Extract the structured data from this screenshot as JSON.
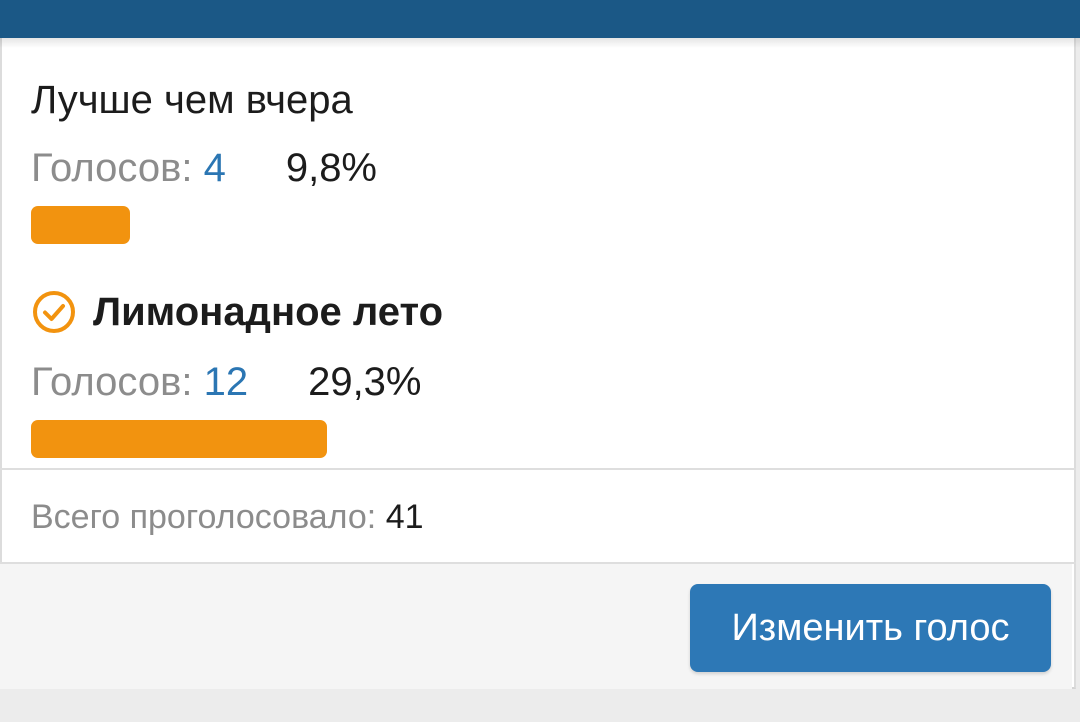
{
  "poll": {
    "options": [
      {
        "title": "Лучше чем вчера",
        "votes_label": "Голосов:",
        "votes": "4",
        "percent": "9,8%",
        "fraction": 0.098,
        "selected": false
      },
      {
        "title": "Лимонадное лето",
        "votes_label": "Голосов:",
        "votes": "12",
        "percent": "29,3%",
        "fraction": 0.293,
        "selected": true
      }
    ],
    "total_label": "Всего проголосовало:",
    "total_value": "41",
    "change_vote_label": "Изменить голос"
  },
  "colors": {
    "header": "#1b5886",
    "bar": "#f2930f",
    "accent": "#2b76b3",
    "button": "#2d78b6"
  },
  "icons": {
    "selected": "check-circle-icon"
  }
}
